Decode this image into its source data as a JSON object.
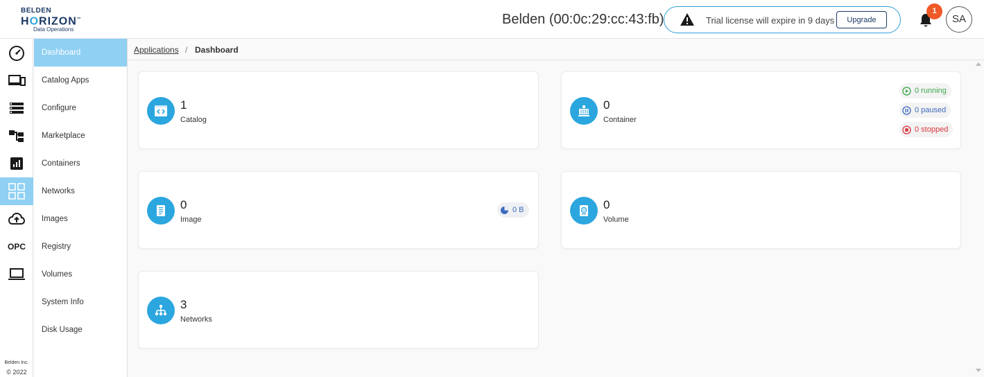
{
  "brand": {
    "line1": "BELDEN",
    "line2a": "H",
    "line2b": "O",
    "line2c": "RIZON",
    "tm": "™",
    "line3": "Data Operations"
  },
  "header": {
    "device_title": "Belden (00:0c:29:cc:43:fb)",
    "license_message": "Trial license will expire in 9 days",
    "upgrade_label": "Upgrade",
    "notification_count": "1",
    "avatar_initials": "SA"
  },
  "rail": {
    "opc_label": "OPC",
    "footer_line1": "Belden Inc.",
    "footer_line2": "© 2022"
  },
  "menu": {
    "items": [
      {
        "label": "Dashboard"
      },
      {
        "label": "Catalog Apps"
      },
      {
        "label": "Configure"
      },
      {
        "label": "Marketplace"
      },
      {
        "label": "Containers"
      },
      {
        "label": "Networks"
      },
      {
        "label": "Images"
      },
      {
        "label": "Registry"
      },
      {
        "label": "Volumes"
      },
      {
        "label": "System Info"
      },
      {
        "label": "Disk Usage"
      }
    ]
  },
  "breadcrumb": {
    "parent": "Applications",
    "separator": "/",
    "current": "Dashboard"
  },
  "cards": {
    "catalog": {
      "count": "1",
      "label": "Catalog"
    },
    "container": {
      "count": "0",
      "label": "Container",
      "running": "0 running",
      "paused": "0 paused",
      "stopped": "0 stopped"
    },
    "image": {
      "count": "0",
      "label": "Image",
      "size": "0 B"
    },
    "volume": {
      "count": "0",
      "label": "Volume"
    },
    "networks": {
      "count": "3",
      "label": "Networks"
    }
  },
  "colors": {
    "accent": "#2ba6de",
    "active_menu": "#8fd0f3",
    "running": "#3aa84a",
    "paused": "#3e6bbf",
    "stopped": "#d9363e",
    "badge": "#f05a28"
  }
}
